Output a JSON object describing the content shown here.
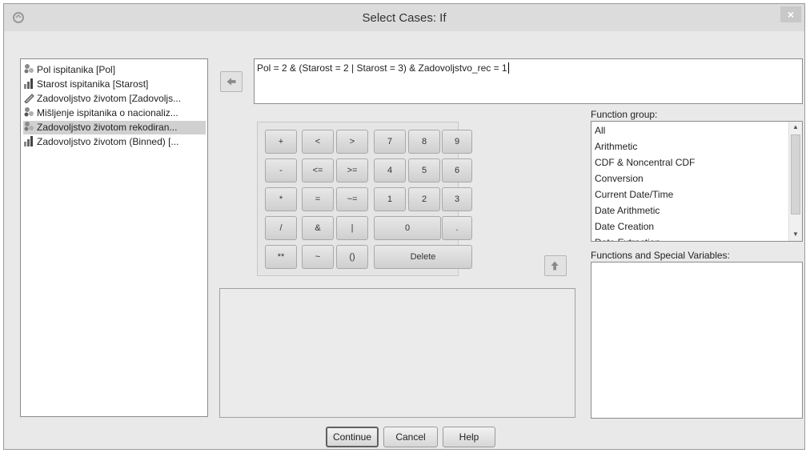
{
  "title": "Select Cases: If",
  "variables": [
    {
      "label": "Pol ispitanika [Pol]",
      "icon": "nominal-variable-icon",
      "selected": false
    },
    {
      "label": "Starost ispitanika [Starost]",
      "icon": "ordinal-variable-icon",
      "selected": false
    },
    {
      "label": "Zadovoljstvo životom [Zadovoljs...",
      "icon": "scale-variable-icon",
      "selected": false
    },
    {
      "label": "Mišljenje ispitanika o nacionaliz...",
      "icon": "nominal-variable-icon",
      "selected": false
    },
    {
      "label": "Zadovoljstvo životom rekodiran...",
      "icon": "nominal-variable-icon",
      "selected": true
    },
    {
      "label": "Zadovoljstvo životom (Binned) [...",
      "icon": "ordinal-variable-icon",
      "selected": false
    }
  ],
  "expression": "Pol = 2 & (Starost = 2 | Starost = 3) & Zadovoljstvo_rec = 1",
  "keypad": {
    "keys": [
      "+",
      "<",
      ">",
      "7",
      "8",
      "9",
      "-",
      "<=",
      ">=",
      "4",
      "5",
      "6",
      "*",
      "=",
      "~=",
      "1",
      "2",
      "3",
      "/",
      "&",
      "|",
      "0",
      ".",
      "**",
      "~",
      "()",
      "Delete"
    ]
  },
  "function_group": {
    "label": "Function group:",
    "items": [
      "All",
      "Arithmetic",
      "CDF & Noncentral CDF",
      "Conversion",
      "Current Date/Time",
      "Date Arithmetic",
      "Date Creation",
      "Date Extraction"
    ]
  },
  "functions_label": "Functions and Special Variables:",
  "buttons": {
    "continue": "Continue",
    "cancel": "Cancel",
    "help": "Help"
  },
  "close_glyph": "×"
}
